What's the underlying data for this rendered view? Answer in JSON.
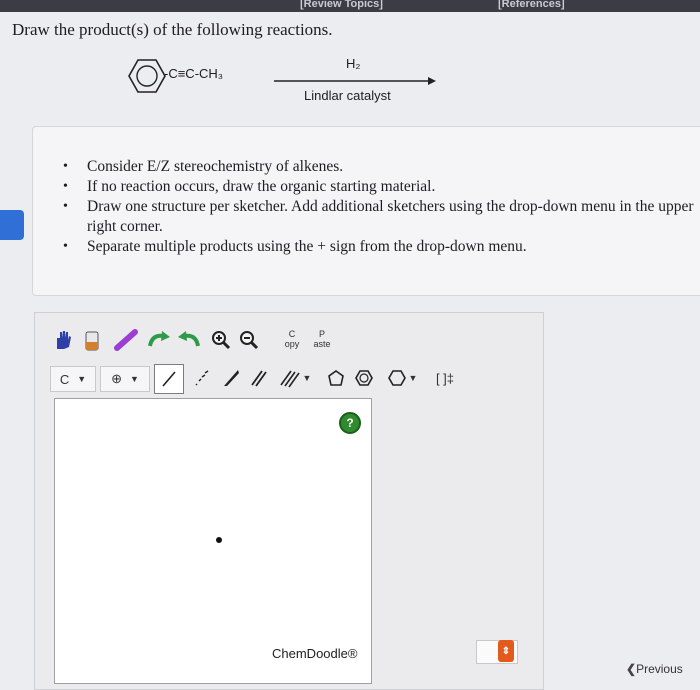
{
  "header": {
    "left_link": "[Review Topics]",
    "right_link": "[References]"
  },
  "question": "Draw the product(s) of the following reactions.",
  "reaction": {
    "substituent": "-C≡C-CH₃",
    "reagent": "H₂",
    "catalyst": "Lindlar catalyst"
  },
  "instructions": [
    "Consider E/Z stereochemistry of alkenes.",
    "If no reaction occurs, draw the organic starting material.",
    "Draw one structure per sketcher. Add additional sketchers using the drop-down menu in the upper right corner.",
    "Separate multiple products using the + sign from the drop-down menu."
  ],
  "toolbar": {
    "copy_label": "C opy",
    "paste_label": "P aste",
    "atom_label": "C",
    "charge_symbol": "⊕",
    "bracket_label": "[ ]‡"
  },
  "canvas": {
    "help_label": "?"
  },
  "footer": {
    "brand": "ChemDoodle®",
    "previous": "Previous"
  }
}
